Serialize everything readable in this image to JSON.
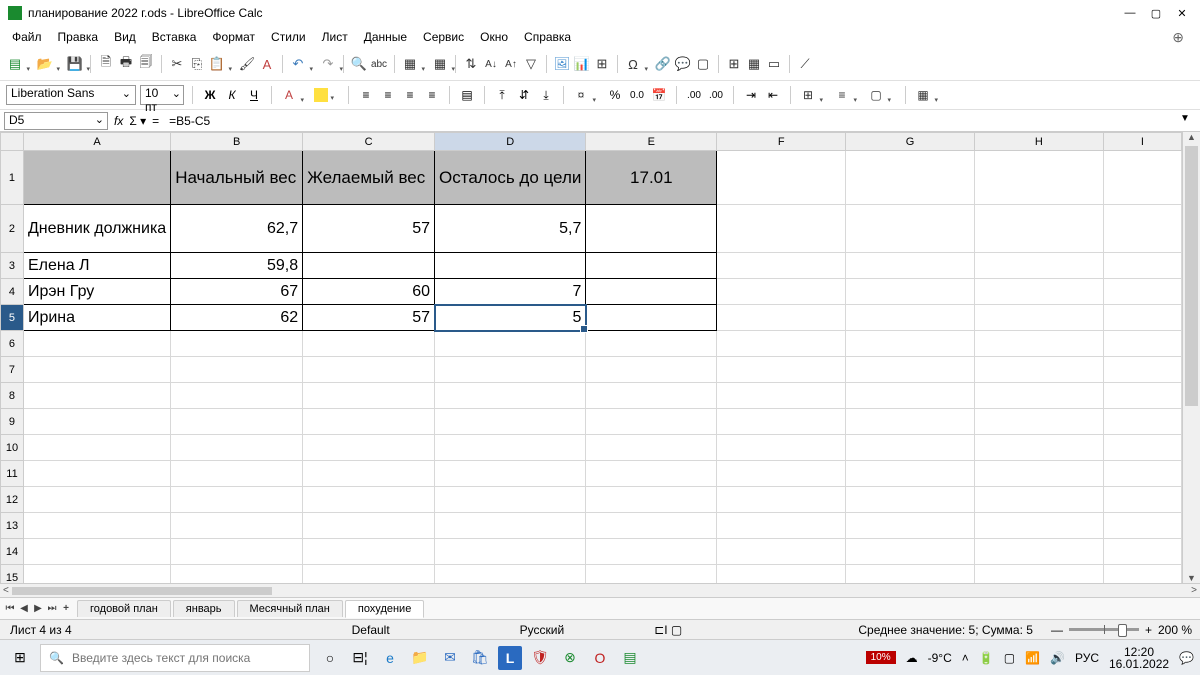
{
  "title": "планирование 2022 г.ods - LibreOffice Calc",
  "menu": [
    "Файл",
    "Правка",
    "Вид",
    "Вставка",
    "Формат",
    "Стили",
    "Лист",
    "Данные",
    "Сервис",
    "Окно",
    "Справка"
  ],
  "font": {
    "name": "Liberation Sans",
    "size": "10 пт"
  },
  "cell_ref": "D5",
  "formula": "=B5-C5",
  "cols": [
    "A",
    "B",
    "C",
    "D",
    "E",
    "F",
    "G",
    "H",
    "I"
  ],
  "headers": {
    "b": "Начальный вес",
    "c": "Желаемый вес",
    "d": "Осталось до цели",
    "e": "17.01"
  },
  "rows": [
    {
      "n": "2",
      "a": "Дневник должника",
      "b": "62,7",
      "c": "57",
      "d": "5,7",
      "e": ""
    },
    {
      "n": "3",
      "a": "Елена Л",
      "b": "59,8",
      "c": "",
      "d": "",
      "e": ""
    },
    {
      "n": "4",
      "a": "Ирэн Гру",
      "b": "67",
      "c": "60",
      "d": "7",
      "e": ""
    },
    {
      "n": "5",
      "a": "Ирина",
      "b": "62",
      "c": "57",
      "d": "5",
      "e": ""
    }
  ],
  "tabs": {
    "nav": [
      "◂",
      "◂",
      "▸",
      "▸",
      "+"
    ],
    "items": [
      "годовой план",
      "январь",
      "Месячный план",
      "похудение"
    ],
    "active": 3
  },
  "status": {
    "sheet": "Лист 4 из 4",
    "style": "Default",
    "lang": "Русский",
    "summary": "Среднее значение: 5; Сумма: 5",
    "zoom": "200 %"
  },
  "taskbar": {
    "search_ph": "Введите здесь текст для поиска",
    "battery": "10%",
    "weather": "-9°C",
    "lang": "РУС",
    "time": "12:20",
    "date": "16.01.2022"
  }
}
